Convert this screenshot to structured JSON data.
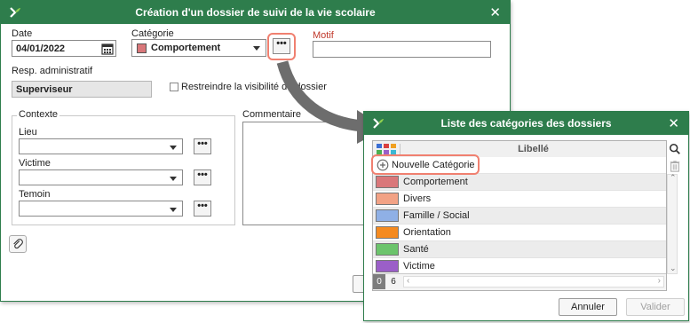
{
  "main_dialog": {
    "title": "Création d'un dossier de suivi de la vie scolaire",
    "date_label": "Date",
    "date_value": "04/01/2022",
    "categorie_label": "Catégorie",
    "categorie_value": "Comportement",
    "categorie_color": "#d9777a",
    "motif_label": "Motif",
    "resp_label": "Resp. administratif",
    "resp_value": "Superviseur",
    "restreindre_label": "Restreindre la visibilité du dossier",
    "contexte_legend": "Contexte",
    "lieu_label": "Lieu",
    "victime_label": "Victime",
    "temoin_label": "Temoin",
    "commentaire_label": "Commentaire",
    "dots": "•••"
  },
  "list_dialog": {
    "title": "Liste des catégories des dossiers",
    "column_header": "Libellé",
    "new_category_label": "Nouvelle Catégorie",
    "categories": [
      {
        "name": "Comportement",
        "color": "#d9777a"
      },
      {
        "name": "Divers",
        "color": "#f2a285"
      },
      {
        "name": "Famille / Social",
        "color": "#8fb0e6"
      },
      {
        "name": "Orientation",
        "color": "#f58a1f"
      },
      {
        "name": "Santé",
        "color": "#6cc46c"
      },
      {
        "name": "Victime",
        "color": "#9b5fc8"
      }
    ],
    "count_left": "0",
    "count_right": "6",
    "annuler_label": "Annuler",
    "valider_label": "Valider"
  },
  "colors": {
    "title_bar": "#2e7d4c",
    "highlight": "#f08070",
    "arrow": "#6d6d6d"
  }
}
